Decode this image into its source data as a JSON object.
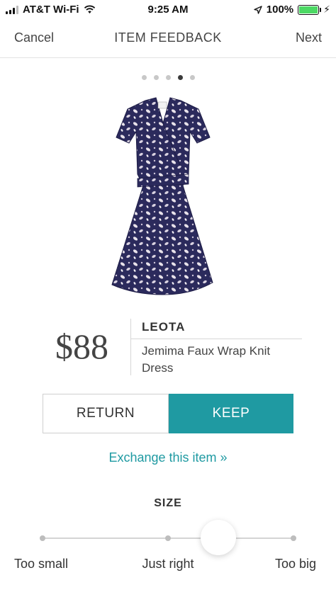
{
  "status_bar": {
    "carrier": "AT&T Wi-Fi",
    "time": "9:25 AM",
    "battery": "100%",
    "battery_level": 1.0,
    "signal_icon": "signal-bars-icon",
    "wifi_icon": "wifi-icon",
    "location_icon": "location-arrow-icon",
    "charge_icon": "lightning-icon"
  },
  "nav": {
    "cancel_label": "Cancel",
    "title": "ITEM FEEDBACK",
    "next_label": "Next"
  },
  "pager": {
    "count": 5,
    "active_index": 3
  },
  "product": {
    "image_icon": "wrap-dress-image",
    "price": "$88",
    "brand": "LEOTA",
    "name": "Jemima Faux Wrap Knit Dress"
  },
  "actions": {
    "return_label": "RETURN",
    "keep_label": "KEEP",
    "exchange_label": "Exchange this item »"
  },
  "size": {
    "title": "SIZE",
    "labels": [
      "Too small",
      "Just right",
      "Too big"
    ],
    "slider_value": 0.7
  },
  "colors": {
    "accent": "#1f9aa2",
    "dress_base": "#2b2a5c",
    "battery_green": "#4cd964"
  }
}
